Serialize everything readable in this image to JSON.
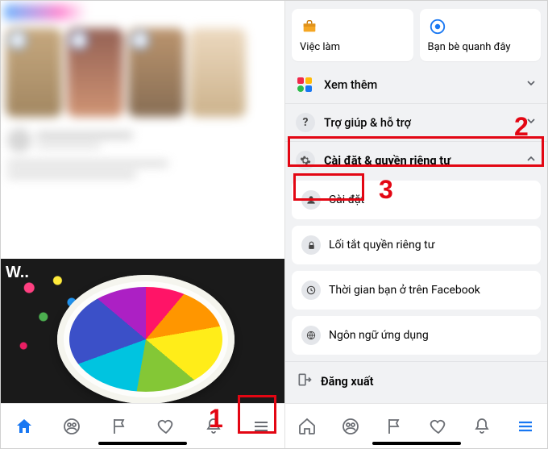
{
  "annotations": {
    "step1": "1",
    "step2": "2",
    "step3": "3"
  },
  "left": {
    "nav": {
      "home": "home",
      "groups": "groups",
      "flag": "pages",
      "dating": "dating",
      "notifications": "notifications",
      "menu": "menu"
    }
  },
  "right": {
    "shortcut_jobs": "Việc làm",
    "shortcut_nearby": "Bạn bè quanh đây",
    "see_more": "Xem thêm",
    "help": "Trợ giúp & hỗ trợ",
    "settings_privacy": "Cài đặt & quyền riêng tư",
    "submenu": {
      "settings": "Cài đặt",
      "privacy_shortcuts": "Lối tắt quyền riêng tư",
      "your_time": "Thời gian bạn ở trên Facebook",
      "language": "Ngôn ngữ ứng dụng"
    },
    "logout": "Đăng xuất"
  },
  "colors": {
    "accent": "#1877f2",
    "annotation": "#e30613"
  }
}
